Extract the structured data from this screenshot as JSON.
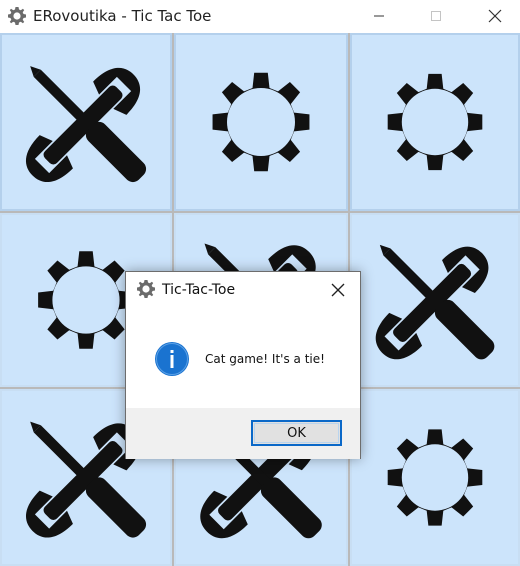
{
  "window": {
    "title": "ERovoutika - Tic Tac Toe",
    "icon": "gear-icon",
    "controls": [
      "minimize-icon",
      "maximize-icon",
      "close-icon"
    ]
  },
  "board": {
    "cell_color": "#cce4fb",
    "cells": [
      {
        "mark": "tools"
      },
      {
        "mark": "gear"
      },
      {
        "mark": "gear"
      },
      {
        "mark": "gear"
      },
      {
        "mark": "tools"
      },
      {
        "mark": "tools"
      },
      {
        "mark": "tools"
      },
      {
        "mark": "tools"
      },
      {
        "mark": "gear"
      }
    ]
  },
  "dialog": {
    "title": "Tic-Tac-Toe",
    "icon": "info-icon",
    "message": "Cat game! It's a tie!",
    "ok_label": "OK",
    "accent": "#0a68c8"
  }
}
